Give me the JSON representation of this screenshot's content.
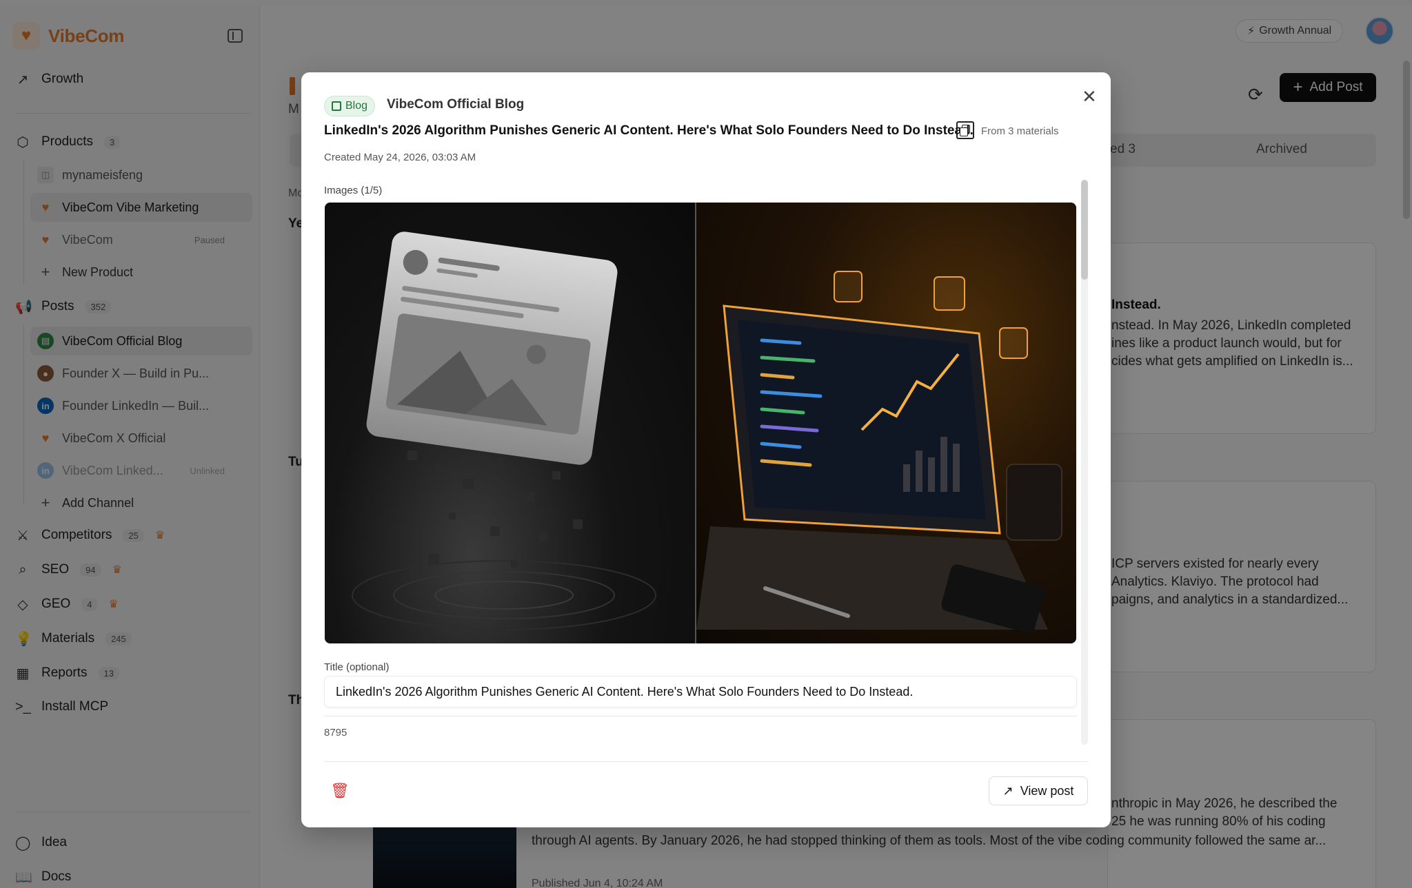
{
  "brand": {
    "name": "VibeCom"
  },
  "sidebar": {
    "growth": "Growth",
    "products": {
      "label": "Products",
      "count": "3",
      "items": [
        {
          "label": "mynameisfeng",
          "tag": ""
        },
        {
          "label": "VibeCom Vibe Marketing",
          "tag": ""
        },
        {
          "label": "VibeCom",
          "tag": "Paused"
        }
      ],
      "new": "New Product"
    },
    "posts": {
      "label": "Posts",
      "count": "352",
      "items": [
        {
          "label": "VibeCom Official Blog",
          "tag": ""
        },
        {
          "label": "Founder X — Build in Pu...",
          "tag": ""
        },
        {
          "label": "Founder LinkedIn — Buil...",
          "tag": ""
        },
        {
          "label": "VibeCom X Official",
          "tag": ""
        },
        {
          "label": "VibeCom Linked...",
          "tag": "Unlinked"
        }
      ],
      "add": "Add Channel"
    },
    "competitors": {
      "label": "Competitors",
      "count": "25"
    },
    "seo": {
      "label": "SEO",
      "count": "94"
    },
    "geo": {
      "label": "GEO",
      "count": "4"
    },
    "materials": {
      "label": "Materials",
      "count": "245"
    },
    "reports": {
      "label": "Reports",
      "count": "13"
    },
    "install": "Install MCP",
    "idea": "Idea",
    "docs": "Docs"
  },
  "topbar": {
    "plan": "Growth Annual",
    "add_post": "Add Post"
  },
  "background": {
    "tab_partial": "ed 3",
    "tab_archived": "Archived",
    "left_frags": [
      "M",
      "Mo",
      "Ye",
      "Tu",
      "Th"
    ],
    "card1": {
      "title": "Instead.",
      "lines": [
        "nstead. In May 2026, LinkedIn completed",
        "ines like a product launch would, but for",
        "cides what gets amplified on LinkedIn is..."
      ]
    },
    "card2": {
      "lines": [
        "ICP servers existed for nearly every",
        "Analytics. Klaviyo. The protocol had",
        "paigns, and analytics in a standardized..."
      ]
    },
    "card3": {
      "lines": [
        "nthropic in May 2026, he described the",
        "25 he was running 80% of his coding",
        "through AI agents. By January 2026, he had stopped thinking of them as tools. Most of the vibe coding community followed the same ar..."
      ],
      "published": "Published Jun 4, 10:24 AM"
    }
  },
  "modal": {
    "badge": "Blog",
    "channel": "VibeCom Official Blog",
    "title": "LinkedIn's 2026 Algorithm Punishes Generic AI Content. Here's What Solo Founders Need to Do Instead.",
    "from_materials": "From 3 materials",
    "created": "Created May 24, 2026, 03:03 AM",
    "images_label": "Images (1/5)",
    "title_label": "Title (optional)",
    "title_value": "LinkedIn's 2026 Algorithm Punishes Generic AI Content. Here's What Solo Founders Need to Do Instead.",
    "char_count": "8795",
    "view_post": "View post"
  },
  "colors": {
    "brand": "#e97a2b",
    "blog_green": "#1e7a3a",
    "delete_red": "#dd3333"
  }
}
